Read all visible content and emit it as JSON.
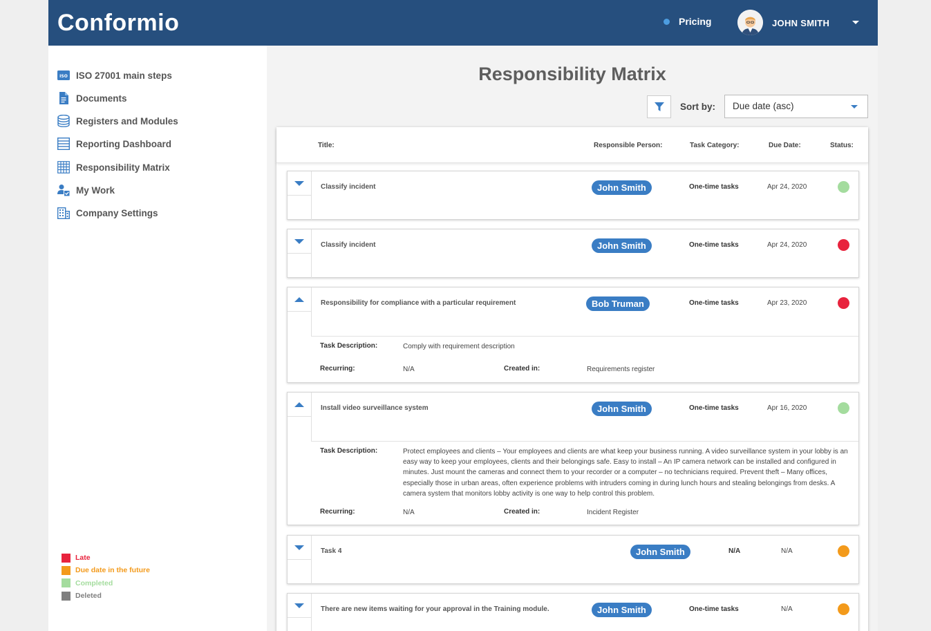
{
  "app": {
    "logo": "Conformio",
    "pricing_label": "Pricing",
    "username": "JOHN SMITH"
  },
  "sidebar": {
    "items": [
      {
        "label": "ISO 27001 main steps",
        "icon": "iso-badge-icon"
      },
      {
        "label": "Documents",
        "icon": "document-icon"
      },
      {
        "label": "Registers and Modules",
        "icon": "database-icon"
      },
      {
        "label": "Reporting Dashboard",
        "icon": "list-icon"
      },
      {
        "label": "Responsibility Matrix",
        "icon": "grid-icon"
      },
      {
        "label": "My Work",
        "icon": "user-check-icon"
      },
      {
        "label": "Company Settings",
        "icon": "building-icon"
      }
    ],
    "iso_badge_text": "ISO",
    "legend": [
      {
        "label": "Late",
        "color": "#e8233d"
      },
      {
        "label": "Due date in the future",
        "color": "#f39a1b"
      },
      {
        "label": "Completed",
        "color": "#a4dc9e"
      },
      {
        "label": "Deleted",
        "color": "#7f7f7f"
      }
    ]
  },
  "main": {
    "page_title": "Responsibility Matrix",
    "sort_label": "Sort by:",
    "sort_value": "Due date (asc)",
    "columns": {
      "title": "Title:",
      "person": "Responsible Person:",
      "category": "Task Category:",
      "due": "Due Date:",
      "status": "Status:"
    },
    "detail_labels": {
      "description": "Task Description:",
      "recurring": "Recurring:",
      "created_in": "Created in:"
    },
    "tasks": [
      {
        "title": "Classify incident",
        "person": "John Smith",
        "category": "One-time tasks",
        "due": "Apr 24, 2020",
        "status_color": "#a4dc9e",
        "expanded": false
      },
      {
        "title": "Classify incident",
        "person": "John Smith",
        "category": "One-time tasks",
        "due": "Apr 24, 2020",
        "status_color": "#e8233d",
        "expanded": false
      },
      {
        "title": "Responsibility for compliance with a particular requirement",
        "person": "Bob Truman",
        "category": "One-time tasks",
        "due": "Apr 23, 2020",
        "status_color": "#e8233d",
        "expanded": true,
        "description": "Comply with requirement description",
        "recurring": "N/A",
        "created_in": "Requirements register"
      },
      {
        "title": "Install video surveillance system",
        "person": "John Smith",
        "category": "One-time tasks",
        "due": "Apr 16, 2020",
        "status_color": "#a4dc9e",
        "expanded": true,
        "description": "Protect employees and clients – Your employees and clients are what keep your business running. A video surveillance system in your lobby is an easy way to keep your employees, clients and their belongings safe. Easy to install – An IP camera network can be installed and configured in minutes. Just mount the cameras and connect them to your recorder or a computer – no technicians required. Prevent theft – Many offices, especially those in urban areas, often experience problems with intruders coming in during lunch hours and stealing belongings from desks. A camera system that monitors lobby activity is one way to help control this problem.",
        "recurring": "N/A",
        "created_in": "Incident Register"
      },
      {
        "title": "Task 4",
        "person": "John Smith",
        "category": "N/A",
        "due": "N/A",
        "status_color": "#f39a1b",
        "expanded": false
      },
      {
        "title": "There are new items waiting for your approval in the Training module.",
        "person": "John Smith",
        "category": "One-time tasks",
        "due": "N/A",
        "status_color": "#f39a1b",
        "expanded": false
      }
    ]
  }
}
